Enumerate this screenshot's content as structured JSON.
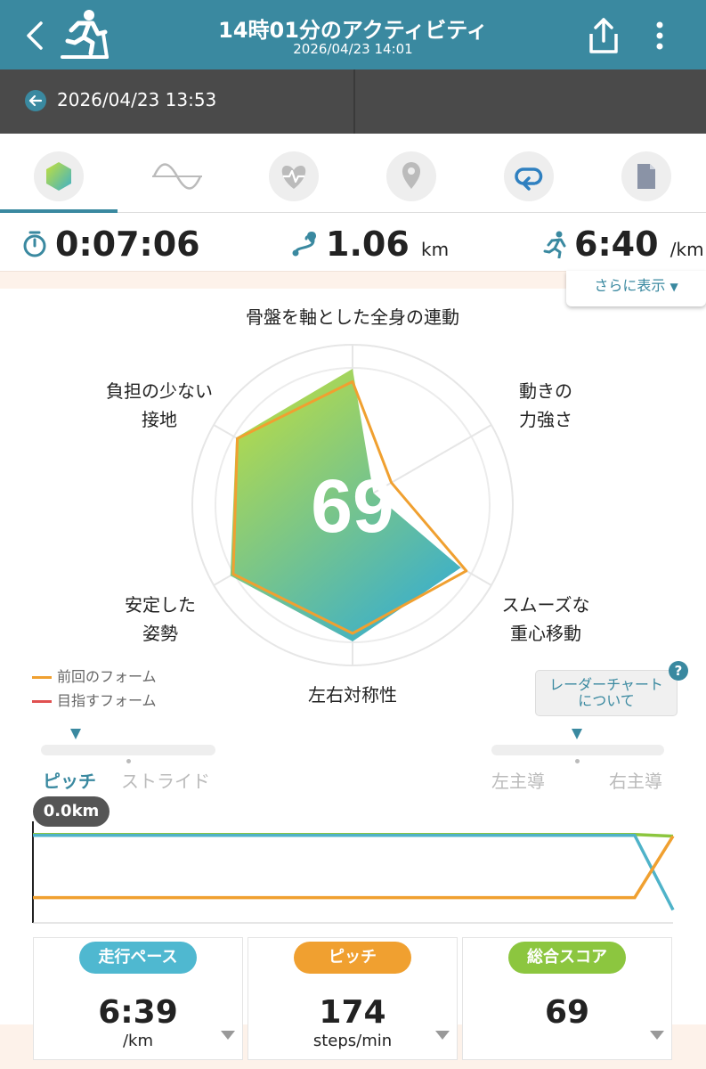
{
  "header": {
    "title": "14時01分のアクティビティ",
    "datetime": "2026/04/23 14:01",
    "color": "#3a89a0"
  },
  "previous": {
    "datetime": "2026/04/23 13:53"
  },
  "tabs": [
    {
      "icon": "form-hexagon-icon",
      "active": true
    },
    {
      "icon": "wave-icon",
      "active": false
    },
    {
      "icon": "heart-rate-icon",
      "active": false
    },
    {
      "icon": "map-pin-icon",
      "active": false
    },
    {
      "icon": "lap-loop-icon",
      "active": false
    },
    {
      "icon": "document-icon",
      "active": false
    }
  ],
  "metrics": {
    "time": "0:07:06",
    "distance": "1.06",
    "distance_unit": "km",
    "pace": "6:40",
    "pace_unit": "/km"
  },
  "more_label": "さらに表示",
  "radar": {
    "score": "69",
    "axes": [
      {
        "label": "骨盤を軸とした全身の連動",
        "current": 0.85,
        "previous": 0.77
      },
      {
        "label": "動きの\n力強さ",
        "current": 0.15,
        "previous": 0.28
      },
      {
        "label": "スムーズな\n重心移動",
        "current": 0.78,
        "previous": 0.82
      },
      {
        "label": "左右対称性",
        "current": 0.85,
        "previous": 0.8
      },
      {
        "label": "安定した\n姿勢",
        "current": 0.88,
        "previous": 0.86
      },
      {
        "label": "負担の少ない\n接地",
        "current": 0.84,
        "previous": 0.83
      }
    ],
    "legend": [
      {
        "label": "前回のフォーム",
        "color": "#f0a030"
      },
      {
        "label": "目指すフォーム",
        "color": "#e05050"
      }
    ],
    "about_button": "レーダーチャート\nについて",
    "help": "?"
  },
  "selectors": {
    "left": [
      "ピッチ",
      "ストライド"
    ],
    "right": [
      "左主導",
      "右主導"
    ]
  },
  "line_chart": {
    "badge": "0.0km",
    "series": [
      {
        "name": "green",
        "color": "#8cc63f",
        "points": [
          [
            0,
            0.03
          ],
          [
            0.94,
            0.03
          ],
          [
            1,
            0.05
          ]
        ]
      },
      {
        "name": "teal",
        "color": "#4fb3c9",
        "points": [
          [
            0,
            0.04
          ],
          [
            0.94,
            0.04
          ],
          [
            1,
            0.95
          ]
        ]
      },
      {
        "name": "orange",
        "color": "#f0a030",
        "points": [
          [
            0,
            0.8
          ],
          [
            0.94,
            0.8
          ],
          [
            1,
            0.05
          ]
        ]
      }
    ]
  },
  "cards": [
    {
      "label": "走行ペース",
      "value": "6:39",
      "unit": "/km",
      "color": "#4fb8d0"
    },
    {
      "label": "ピッチ",
      "value": "174",
      "unit": "steps/min",
      "color": "#f0a030"
    },
    {
      "label": "総合スコア",
      "value": "69",
      "unit": "",
      "color": "#8cc63f"
    }
  ]
}
